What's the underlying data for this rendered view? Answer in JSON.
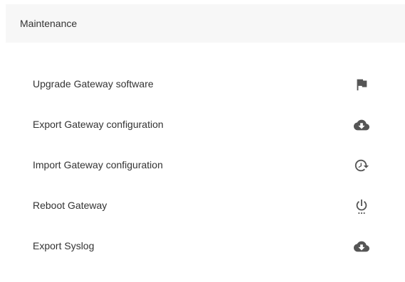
{
  "header": {
    "title": "Maintenance"
  },
  "actions": [
    {
      "label": "Upgrade Gateway software",
      "icon": "flag-icon"
    },
    {
      "label": "Export Gateway configuration",
      "icon": "cloud-download-icon"
    },
    {
      "label": "Import Gateway configuration",
      "icon": "restore-icon"
    },
    {
      "label": "Reboot Gateway",
      "icon": "power-settings-icon"
    },
    {
      "label": "Export Syslog",
      "icon": "cloud-download-icon"
    }
  ],
  "colors": {
    "header_bg": "#f7f7f7",
    "text": "#333333",
    "icon": "#555555"
  }
}
